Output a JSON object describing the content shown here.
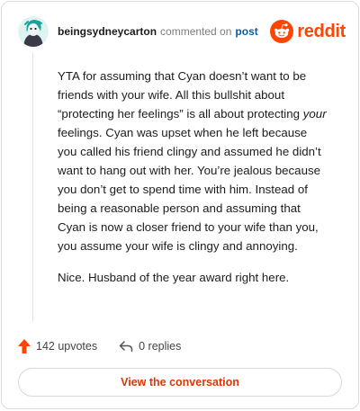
{
  "header": {
    "username": "beingsydneycarton",
    "commented_text": "commented on",
    "post_link": "post",
    "brand_wordmark": "reddit"
  },
  "comment": {
    "paragraph_1_pre": "YTA for assuming that Cyan doesn’t want to be friends with your wife. All this bullshit about “protecting her feelings” is all about protecting ",
    "paragraph_1_em": "your",
    "paragraph_1_post": " feelings. Cyan was upset when he left because you called his friend clingy and assumed he didn’t want to hang out with her. You’re jealous because you don’t get to spend time with him. Instead of being a reasonable person and assuming that Cyan is now a closer friend to your wife than you, you assume your wife is clingy and annoying.",
    "paragraph_2": "Nice. Husband of the year award right here."
  },
  "actions": {
    "upvotes": "142 upvotes",
    "replies": "0 replies"
  },
  "cta": {
    "label": "View the conversation"
  },
  "icons": {
    "avatar": "user-avatar",
    "brand": "reddit-snoo-icon",
    "upvote": "upvote-arrow-icon",
    "reply": "reply-arrow-icon"
  },
  "colors": {
    "brand": "#ff4500",
    "link": "#0a5c9e",
    "cta_text": "#d93900"
  }
}
